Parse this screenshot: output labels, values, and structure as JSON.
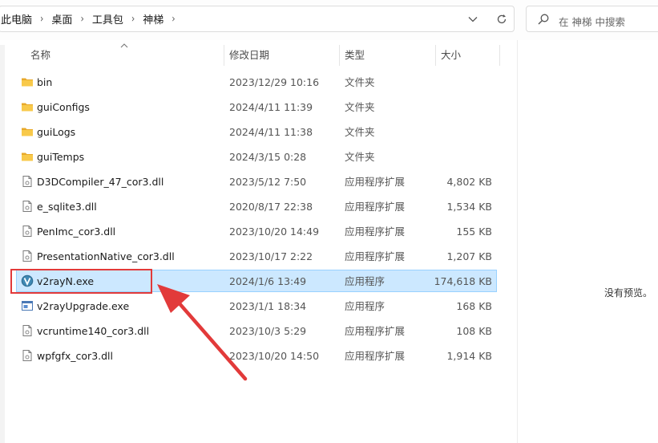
{
  "breadcrumb": [
    "此电脑",
    "桌面",
    "工具包",
    "神梯"
  ],
  "search": {
    "placeholder": "在 神梯 中搜索"
  },
  "columns": {
    "name": "名称",
    "modified": "修改日期",
    "type": "类型",
    "size": "大小"
  },
  "files": [
    {
      "name": "bin",
      "modified": "2023/12/29 10:16",
      "type": "文件夹",
      "size": "",
      "icon": "folder-icon"
    },
    {
      "name": "guiConfigs",
      "modified": "2024/4/11 11:39",
      "type": "文件夹",
      "size": "",
      "icon": "folder-icon"
    },
    {
      "name": "guiLogs",
      "modified": "2024/4/11 11:38",
      "type": "文件夹",
      "size": "",
      "icon": "folder-icon"
    },
    {
      "name": "guiTemps",
      "modified": "2024/3/15 0:28",
      "type": "文件夹",
      "size": "",
      "icon": "folder-icon"
    },
    {
      "name": "D3DCompiler_47_cor3.dll",
      "modified": "2023/5/12 7:50",
      "type": "应用程序扩展",
      "size": "4,802 KB",
      "icon": "dll-file-icon"
    },
    {
      "name": "e_sqlite3.dll",
      "modified": "2020/8/17 22:38",
      "type": "应用程序扩展",
      "size": "1,534 KB",
      "icon": "dll-file-icon"
    },
    {
      "name": "PenImc_cor3.dll",
      "modified": "2023/10/20 14:49",
      "type": "应用程序扩展",
      "size": "155 KB",
      "icon": "dll-file-icon"
    },
    {
      "name": "PresentationNative_cor3.dll",
      "modified": "2023/10/17 2:22",
      "type": "应用程序扩展",
      "size": "1,207 KB",
      "icon": "dll-file-icon"
    },
    {
      "name": "v2rayN.exe",
      "modified": "2024/1/6 13:49",
      "type": "应用程序",
      "size": "174,618 KB",
      "icon": "v2rayn-app-icon",
      "selected": true
    },
    {
      "name": "v2rayUpgrade.exe",
      "modified": "2023/1/1 18:34",
      "type": "应用程序",
      "size": "168 KB",
      "icon": "exe-window-icon"
    },
    {
      "name": "vcruntime140_cor3.dll",
      "modified": "2023/10/3 5:29",
      "type": "应用程序扩展",
      "size": "108 KB",
      "icon": "dll-file-icon"
    },
    {
      "name": "wpfgfx_cor3.dll",
      "modified": "2023/10/20 14:50",
      "type": "应用程序扩展",
      "size": "1,914 KB",
      "icon": "dll-file-icon"
    }
  ],
  "preview": {
    "text": "没有预览。"
  },
  "colors": {
    "selection": "#cce8ff",
    "selection_border": "#99d1ff",
    "annotation": "#e23a3a",
    "folder": "#f4c245"
  }
}
